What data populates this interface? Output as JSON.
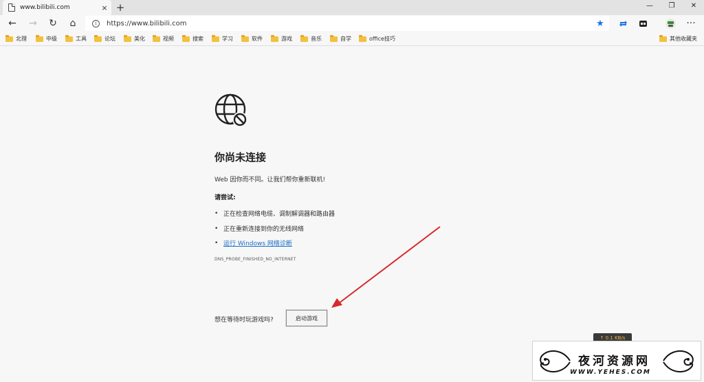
{
  "tab": {
    "title": "www.bilibili.com",
    "close": "×",
    "new_tab": "+"
  },
  "window_controls": {
    "minimize": "—",
    "maximize": "❐",
    "close": "✕"
  },
  "nav": {
    "back": "←",
    "forward": "→",
    "reload": "↻",
    "home": "⌂",
    "more": "···"
  },
  "address": {
    "url": "https://www.bilibili.com",
    "info": "i",
    "star": "★"
  },
  "bookmarks": [
    "北理",
    "中级",
    "工具",
    "论坛",
    "美化",
    "视频",
    "搜索",
    "学习",
    "软件",
    "游戏",
    "音乐",
    "自学",
    "office技巧"
  ],
  "other_bookmarks": "其他收藏夹",
  "error": {
    "heading": "你尚未连接",
    "description": "Web 因你而不同。让我们帮你重新联机!",
    "try_label": "请尝试:",
    "suggestions": [
      "正在检查网络电缆、调制解调器和路由器",
      "正在重新连接到你的无线网络"
    ],
    "diagnose_link": "运行 Windows 网络诊断",
    "code": "DNS_PROBE_FINISHED_NO_INTERNET",
    "game_question": "想在等待时玩游戏吗?",
    "game_button": "启动游戏"
  },
  "speed": {
    "up": "↑ 0.1 KB/s"
  },
  "watermark": {
    "title": "夜河资源网",
    "url": "WWW.YEHES.COM"
  },
  "colors": {
    "link": "#1a6dc7",
    "star": "#1a73e8",
    "arrow": "#d9292b",
    "folder": "#f3c140"
  }
}
